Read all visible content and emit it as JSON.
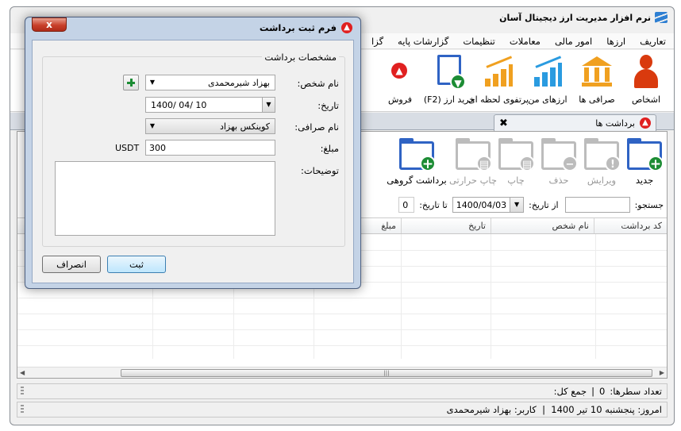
{
  "app": {
    "title": "نرم افزار مدیریت ارز دیجیتال آسان"
  },
  "menu": [
    "تعاریف",
    "ارزها",
    "امور مالی",
    "معاملات",
    "تنظیمات",
    "گزارشات پایه",
    "گزا"
  ],
  "toolbar": [
    {
      "label": "اشخاص",
      "icon": "person-icon"
    },
    {
      "label": "صرافی ها",
      "icon": "bank-icon"
    },
    {
      "label": "ارزهای من",
      "icon": "bar-chart-icon"
    },
    {
      "label": "پرتفوی لحظه ای",
      "icon": "growth-chart-icon"
    },
    {
      "label": "خرید ارز (F2)",
      "icon": "buy-document-icon"
    },
    {
      "label": "فروش",
      "icon": "sell-icon"
    }
  ],
  "tab": {
    "label": "برداشت ها"
  },
  "panel_toolbar": [
    {
      "label": "جدید",
      "enabled": true
    },
    {
      "label": "ویرایش",
      "enabled": false
    },
    {
      "label": "حذف",
      "enabled": false
    },
    {
      "label": "چاپ",
      "enabled": false
    },
    {
      "label": "چاپ حرارتی",
      "enabled": false
    },
    {
      "label": "برداشت گروهی",
      "enabled": true
    }
  ],
  "filter": {
    "search_label": "جستجو:",
    "search_value": "",
    "from_label": "از تاریخ:",
    "from_value": "1400/04/03",
    "to_label": "تا تاریخ:",
    "to_value": "0"
  },
  "grid": {
    "columns": [
      "کد برداشت",
      "نام شخص",
      "تاریخ",
      "مبلغ"
    ]
  },
  "status": {
    "row_count_label": "تعداد سطرها:",
    "row_count": "0",
    "sep": "|",
    "total_label": "جمع کل:",
    "total": ""
  },
  "footer": {
    "text": "امروز: پنجشنبه 10 تیر 1400  |  کاربر: بهزاد شیرمحمدی"
  },
  "dialog": {
    "title": "فرم ثبت برداشت",
    "close": "x",
    "group": "مشخصات برداشت",
    "person_label": "نام شخص:",
    "person_value": "بهزاد شیرمحمدی",
    "date_label": "تاریخ:",
    "date_value": "1400/ 04/ 10",
    "exchange_label": "نام صرافی:",
    "exchange_value": "کوینکس بهزاد",
    "amount_label": "مبلغ:",
    "amount_value": "300",
    "currency": "USDT",
    "notes_label": "توضیحات:",
    "notes_value": "",
    "submit": "ثبت",
    "cancel": "انصراف"
  },
  "colors": {
    "accent": "#2f63c4",
    "add": "#1c8c34",
    "danger": "#e02020",
    "orange": "#f0a020",
    "person": "#d93a0e"
  }
}
